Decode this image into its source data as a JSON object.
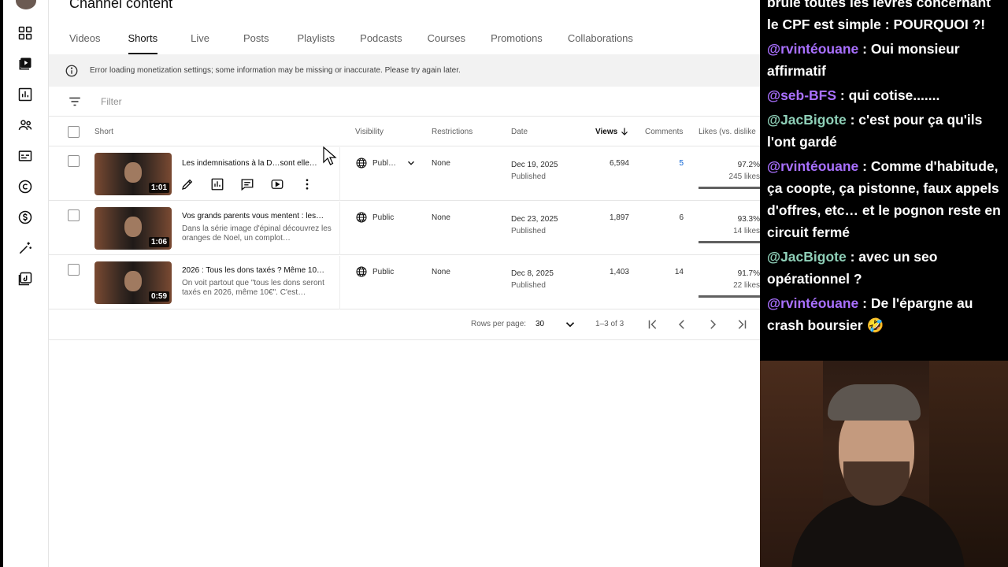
{
  "studio": {
    "page_title": "Channel content",
    "tabs": [
      "Videos",
      "Shorts",
      "Live",
      "Posts",
      "Playlists",
      "Podcasts",
      "Courses",
      "Promotions",
      "Collaborations"
    ],
    "active_tab": "Shorts",
    "banner": "Error loading monetization settings; some information may be missing or inaccurate. Please try again later.",
    "filter_placeholder": "Filter",
    "columns": {
      "short": "Short",
      "visibility": "Visibility",
      "restrictions": "Restrictions",
      "date": "Date",
      "views": "Views",
      "comments": "Comments",
      "likes": "Likes (vs. dislike"
    },
    "rows": [
      {
        "title": "Les indemnisations à la D…sont elle…",
        "desc": "",
        "duration": "1:01",
        "visibility": "Publ…",
        "restrictions": "None",
        "date": "Dec 19, 2025",
        "status": "Published",
        "views": "6,594",
        "comments": "5",
        "likes_pct": "97.2%",
        "likes_count": "245 likes",
        "like_ratio": 0.972
      },
      {
        "title": "Vos grands parents vous mentent : les…",
        "desc": "Dans la série image d'épinal découvrez les oranges de Noel, un complot…",
        "duration": "1:06",
        "visibility": "Public",
        "restrictions": "None",
        "date": "Dec 23, 2025",
        "status": "Published",
        "views": "1,897",
        "comments": "6",
        "likes_pct": "93.3%",
        "likes_count": "14 likes",
        "like_ratio": 0.933
      },
      {
        "title": "2026 : Tous les dons taxés ? Même 10…",
        "desc": "On voit partout que \"tous les dons seront taxés en 2026, même 10€\". C'est…",
        "duration": "0:59",
        "visibility": "Public",
        "restrictions": "None",
        "date": "Dec 8, 2025",
        "status": "Published",
        "views": "1,403",
        "comments": "14",
        "likes_pct": "91.7%",
        "likes_count": "22 likes",
        "like_ratio": 0.917
      }
    ],
    "pager": {
      "rows_per_page_label": "Rows per page:",
      "rows_per_page": "30",
      "range": "1–3 of 3"
    }
  },
  "chat": {
    "first_fragment": "brule toutes les lèvres concernant le CPF est simple : POURQUOI ?!",
    "messages": [
      {
        "user": "@rvintéouane",
        "text": " : Oui monsieur affirmatif"
      },
      {
        "user": "@seb-BFS",
        "text": " : qui cotise......."
      },
      {
        "user": "@JacBigote",
        "text": " : c'est pour ça qu'ils l'ont gardé"
      },
      {
        "user": "@rvintéouane",
        "text": " : Comme d'habitude, ça coopte, ça pistonne, faux appels d'offres, etc… et le pognon reste en circuit fermé"
      },
      {
        "user": "@JacBigote",
        "text": " : avec un seo opérationnel ?"
      },
      {
        "user": "@rvintéouane",
        "text": " : De l'épargne au crash boursier 🤣"
      }
    ]
  },
  "colors": {
    "purple_user": "#a970ff",
    "green_user": "#8fd0b8",
    "link_blue": "#065fd4"
  }
}
